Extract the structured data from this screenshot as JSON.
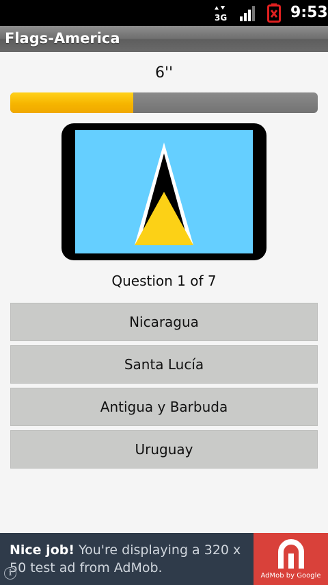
{
  "status_bar": {
    "network": "3G",
    "time": "9:53"
  },
  "title_bar": {
    "title": "Flags-America"
  },
  "quiz": {
    "timer": "6''",
    "time_progress": 0.4,
    "flag": "Saint Lucia flag",
    "question_text": "Question 1 of 7",
    "answers": [
      {
        "label": "Nicaragua"
      },
      {
        "label": "Santa Lucía"
      },
      {
        "label": "Antigua y Barbuda"
      },
      {
        "label": "Uruguay"
      }
    ]
  },
  "ad": {
    "headline": "Nice job!",
    "body": "You're displaying a 320 x 50 test ad from AdMob.",
    "caption": "AdMob by Google",
    "info_icon": "i"
  },
  "colors": {
    "progress_fill": "#f6b500",
    "flag_blue": "#65cfff",
    "flag_yellow": "#fcd116",
    "ad_background": "#2f3b4a",
    "ad_logo_bg": "#d9413a"
  }
}
